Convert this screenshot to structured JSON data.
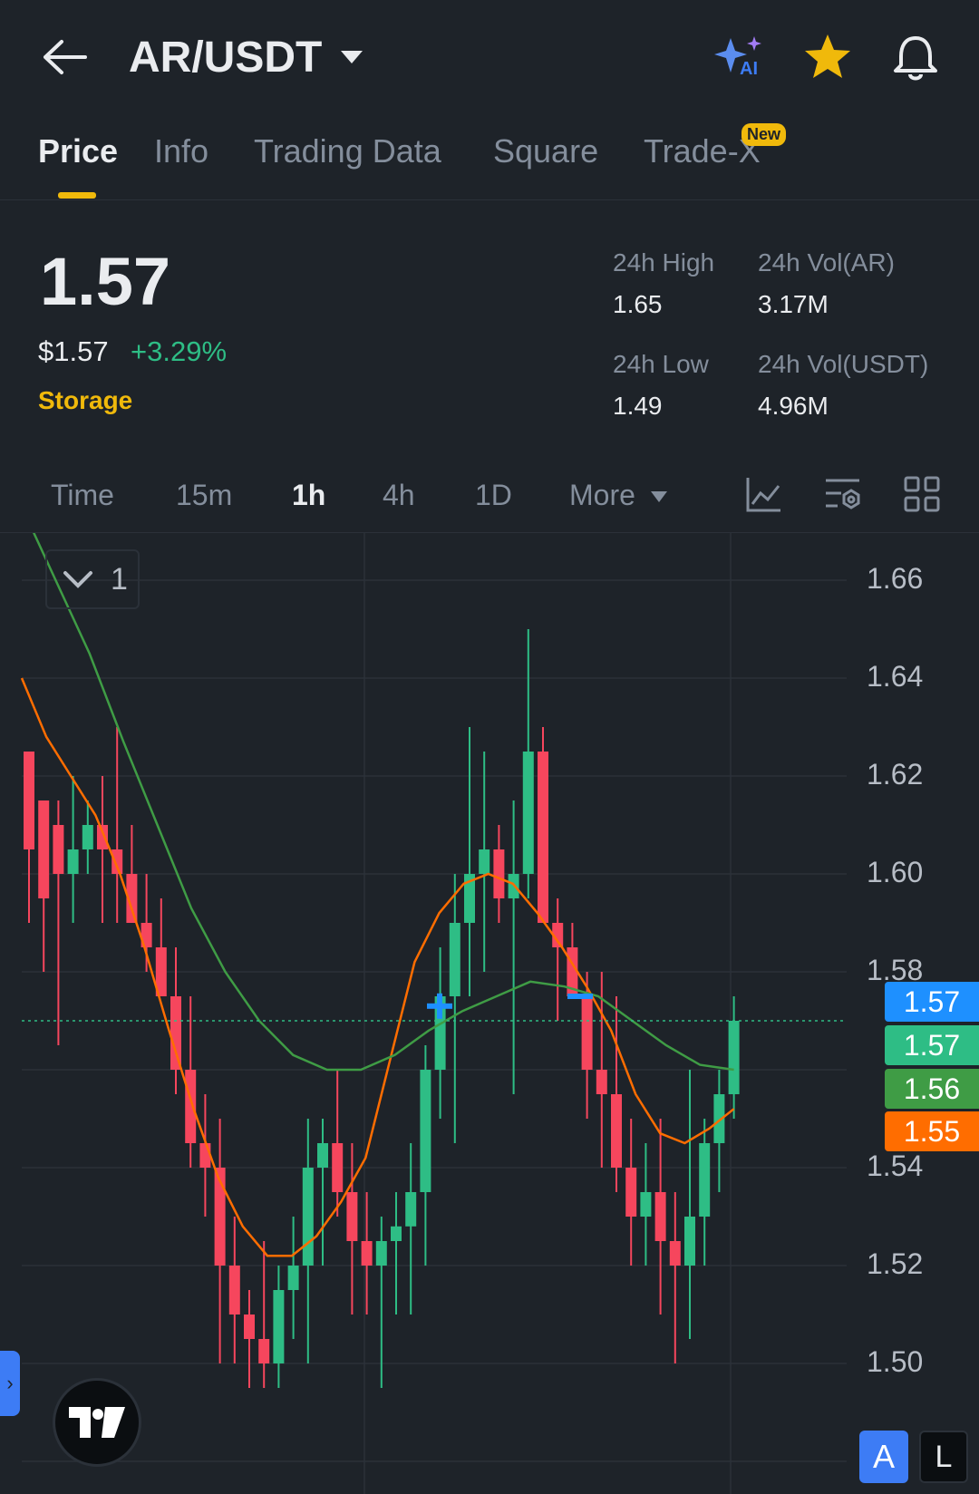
{
  "header": {
    "title": "AR/USDT",
    "icons": [
      "back-arrow-icon",
      "caret-down-icon",
      "ai-sparkle-icon",
      "star-icon",
      "bell-icon"
    ]
  },
  "tabs": [
    {
      "label": "Price",
      "active": true
    },
    {
      "label": "Info"
    },
    {
      "label": "Trading Data"
    },
    {
      "label": "Square"
    },
    {
      "label": "Trade-X",
      "badge": "New"
    }
  ],
  "ticker": {
    "last_price": "1.57",
    "usd_price": "$1.57",
    "change": "+3.29%",
    "tag": "Storage",
    "high_label": "24h High",
    "high_value": "1.65",
    "low_label": "24h Low",
    "low_value": "1.49",
    "vol_base_label": "24h Vol(AR)",
    "vol_base_value": "3.17M",
    "vol_quote_label": "24h Vol(USDT)",
    "vol_quote_value": "4.96M"
  },
  "intervals": [
    {
      "label": "Time"
    },
    {
      "label": "15m"
    },
    {
      "label": "1h",
      "active": true
    },
    {
      "label": "4h"
    },
    {
      "label": "1D"
    },
    {
      "label": "More"
    }
  ],
  "toolbar_icons": [
    "indicator-icon",
    "settings-icon",
    "layout-grid-icon"
  ],
  "chart": {
    "collapse_label": "1",
    "axis_ticks": [
      "1.66",
      "1.64",
      "1.62",
      "1.60",
      "1.58",
      "1.54",
      "1.52",
      "1.50"
    ],
    "price_labels": [
      {
        "value": "1.57",
        "color": "#1e90ff"
      },
      {
        "value": "1.57",
        "color": "#2ebd85"
      },
      {
        "value": "1.56",
        "color": "#3f9c45"
      },
      {
        "value": "1.55",
        "color": "#ff6d00"
      }
    ],
    "bottom_buttons": [
      "A",
      "L"
    ]
  },
  "chart_data": {
    "type": "candlestick",
    "ylim": [
      1.49,
      1.67
    ],
    "up_color": "#2ebd85",
    "down_color": "#f6465d",
    "candles": [
      [
        1.625,
        1.625,
        1.59,
        1.605
      ],
      [
        1.615,
        1.615,
        1.58,
        1.595
      ],
      [
        1.61,
        1.615,
        1.565,
        1.6
      ],
      [
        1.6,
        1.62,
        1.59,
        1.605
      ],
      [
        1.605,
        1.615,
        1.6,
        1.61
      ],
      [
        1.61,
        1.62,
        1.59,
        1.605
      ],
      [
        1.605,
        1.63,
        1.59,
        1.6
      ],
      [
        1.6,
        1.61,
        1.59,
        1.59
      ],
      [
        1.59,
        1.6,
        1.58,
        1.585
      ],
      [
        1.585,
        1.595,
        1.58,
        1.575
      ],
      [
        1.575,
        1.585,
        1.555,
        1.56
      ],
      [
        1.56,
        1.575,
        1.54,
        1.545
      ],
      [
        1.545,
        1.555,
        1.53,
        1.54
      ],
      [
        1.54,
        1.55,
        1.5,
        1.52
      ],
      [
        1.52,
        1.53,
        1.5,
        1.51
      ],
      [
        1.51,
        1.515,
        1.495,
        1.505
      ],
      [
        1.505,
        1.525,
        1.495,
        1.5
      ],
      [
        1.5,
        1.52,
        1.495,
        1.515
      ],
      [
        1.515,
        1.53,
        1.505,
        1.52
      ],
      [
        1.52,
        1.55,
        1.5,
        1.54
      ],
      [
        1.54,
        1.55,
        1.52,
        1.545
      ],
      [
        1.545,
        1.56,
        1.53,
        1.535
      ],
      [
        1.535,
        1.545,
        1.51,
        1.525
      ],
      [
        1.525,
        1.535,
        1.51,
        1.52
      ],
      [
        1.52,
        1.53,
        1.495,
        1.525
      ],
      [
        1.525,
        1.535,
        1.51,
        1.528
      ],
      [
        1.528,
        1.545,
        1.51,
        1.535
      ],
      [
        1.535,
        1.565,
        1.52,
        1.56
      ],
      [
        1.56,
        1.585,
        1.55,
        1.575
      ],
      [
        1.575,
        1.6,
        1.545,
        1.59
      ],
      [
        1.59,
        1.63,
        1.575,
        1.6
      ],
      [
        1.6,
        1.625,
        1.58,
        1.605
      ],
      [
        1.605,
        1.61,
        1.59,
        1.595
      ],
      [
        1.595,
        1.615,
        1.555,
        1.6
      ],
      [
        1.6,
        1.65,
        1.595,
        1.625
      ],
      [
        1.625,
        1.63,
        1.59,
        1.59
      ],
      [
        1.59,
        1.595,
        1.57,
        1.585
      ],
      [
        1.585,
        1.59,
        1.575,
        1.575
      ],
      [
        1.575,
        1.58,
        1.55,
        1.56
      ],
      [
        1.56,
        1.58,
        1.54,
        1.555
      ],
      [
        1.555,
        1.575,
        1.535,
        1.54
      ],
      [
        1.54,
        1.55,
        1.52,
        1.53
      ],
      [
        1.53,
        1.545,
        1.52,
        1.535
      ],
      [
        1.535,
        1.55,
        1.51,
        1.525
      ],
      [
        1.525,
        1.535,
        1.5,
        1.52
      ],
      [
        1.52,
        1.56,
        1.505,
        1.53
      ],
      [
        1.53,
        1.55,
        1.52,
        1.545
      ],
      [
        1.545,
        1.56,
        1.535,
        1.555
      ],
      [
        1.555,
        1.575,
        1.55,
        1.57
      ]
    ],
    "ma_fast": [
      1.64,
      1.628,
      1.62,
      1.612,
      1.6,
      1.585,
      1.568,
      1.552,
      1.538,
      1.528,
      1.522,
      1.522,
      1.526,
      1.533,
      1.542,
      1.562,
      1.582,
      1.592,
      1.598,
      1.6,
      1.598,
      1.592,
      1.585,
      1.577,
      1.568,
      1.555,
      1.547,
      1.545,
      1.548,
      1.552
    ],
    "ma_slow": [
      1.675,
      1.66,
      1.645,
      1.627,
      1.61,
      1.593,
      1.58,
      1.57,
      1.563,
      1.56,
      1.56,
      1.563,
      1.568,
      1.572,
      1.575,
      1.578,
      1.577,
      1.575,
      1.57,
      1.565,
      1.561,
      1.56
    ],
    "markers": [
      {
        "type": "buy",
        "x": 1.573
      },
      {
        "type": "sell",
        "x": 1.575
      }
    ]
  }
}
